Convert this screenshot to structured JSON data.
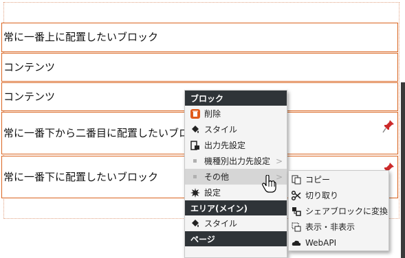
{
  "blocks": [
    {
      "label": "常に一番上に配置したいブロック",
      "pinned": false
    },
    {
      "label": "コンテンツ",
      "pinned": false
    },
    {
      "label": "コンテンツ",
      "pinned": false
    },
    {
      "label": "常に一番下から二番目に配置したいブロック",
      "pinned": true
    },
    {
      "label": "常に一番下に配置したいブロック",
      "pinned": true
    }
  ],
  "context_menu": {
    "block_header": "ブロック",
    "delete": "削除",
    "style": "スタイル",
    "output_setting": "出力先設定",
    "device_output_setting": "機種別出力先設定",
    "other": "その他",
    "settings": "設定",
    "area_header": "エリア(メイン)",
    "area_style": "スタイル",
    "page_header": "ページ",
    "arrow": ">"
  },
  "submenu": {
    "copy": "コピー",
    "cut": "切り取り",
    "convert_shared": "シェアブロックに変換",
    "show_hide": "表示・非表示",
    "webapi": "WebAPI"
  },
  "colors": {
    "block_border": "#d9621c",
    "menu_header": "#2f3438",
    "delete_icon": "#e05a1a",
    "pin": "#cc2a2a"
  },
  "icons": [
    "trash-icon",
    "paint-bucket-icon",
    "output-icon",
    "gear-icon",
    "copy-icon",
    "scissors-icon",
    "share-icon",
    "visibility-icon",
    "cloud-icon",
    "pin-icon",
    "hand-cursor-icon"
  ]
}
